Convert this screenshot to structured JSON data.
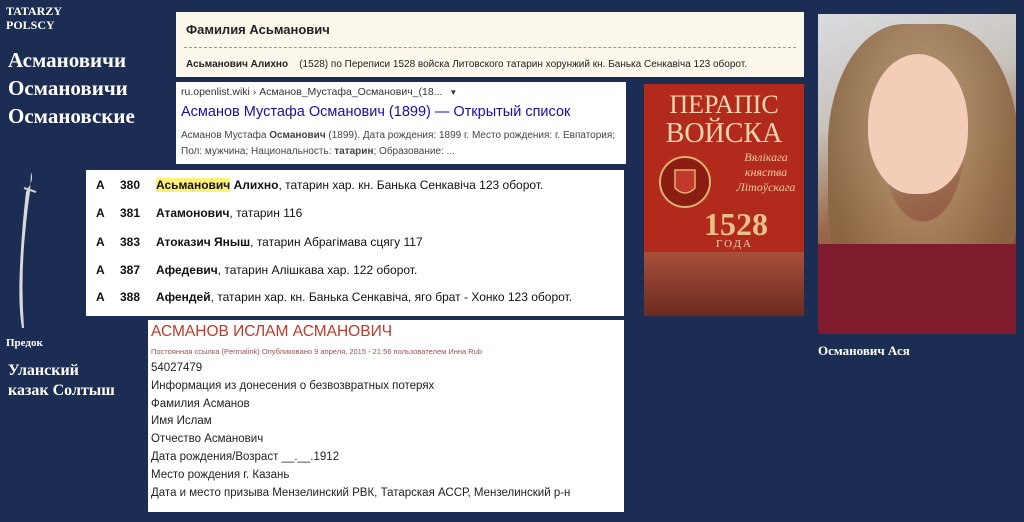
{
  "site_tag": [
    "TATARZY",
    "POLSCY"
  ],
  "surnames": [
    "Асмановичи",
    "Османовичи",
    "Османовские"
  ],
  "ancestor": {
    "label": "Предок",
    "name": [
      "Уланский",
      "казак Солтыш"
    ]
  },
  "panel_dictionary": {
    "title": "Фамилия Асьманович",
    "row_name": "Асьманович Алихно",
    "row_text": "(1528) по Переписи 1528 войска Литовского татарин хорунжий кн. Банька Сенкавіча 123 оборот."
  },
  "panel_search": {
    "url": "ru.openlist.wiki › Асманов_Мустафа_Османович_(18...",
    "url_dropdown": "▼",
    "title": "Асманов Мустафа Османович (1899) — Открытый список",
    "snippet_parts": [
      "Асманов Мустафа ",
      "Османович",
      " (1899). Дата рождения: 1899 г. Место рождения: г. Евпатория; Пол: мужчина; Национальность: ",
      "татарин",
      "; Образование: ..."
    ]
  },
  "panel_list": {
    "rows": [
      {
        "letter": "А",
        "num": "380",
        "name": "Асьманович",
        "name2": " Алихно",
        "rest": ", татарин хар. кн. Банька Сенкавіча 123 оборот.",
        "highlight": true
      },
      {
        "letter": "А",
        "num": "381",
        "name": "Атамонович",
        "name2": "",
        "rest": ", татарин 116",
        "highlight": false
      },
      {
        "letter": "А",
        "num": "383",
        "name": "Атоказич Яныш",
        "name2": "",
        "rest": ", татарин Абрагімава сцягу 117",
        "highlight": false
      },
      {
        "letter": "А",
        "num": "387",
        "name": "Афедевич",
        "name2": "",
        "rest": ", татарин Алішкава хар. 122 оборот.",
        "highlight": false
      },
      {
        "letter": "А",
        "num": "388",
        "name": "Афендей",
        "name2": "",
        "rest": ", татарин хар. кн. Банька Сенкавіча, яго брат - Хонко 123 оборот.",
        "highlight": false
      }
    ]
  },
  "panel_record": {
    "title": "АСМАНОВ ИСЛАМ АСМАНОВИЧ",
    "meta": "Постоянная ссылка (Permalink) Опубликовано 9 апреля, 2015 - 21:56 пользователем Инна Rub",
    "lines": [
      "54027479",
      "Информация из донесения о безвозвратных потерях",
      "Фамилия Асманов",
      "Имя Ислам",
      "Отчество Асманович",
      "Дата рождения/Возраст __.__.1912",
      "Место рождения г. Казань",
      "Дата и место призыва Мензелинский РВК, Татарская АССР, Мензелинский р-н"
    ]
  },
  "book": {
    "title1": "ПЕРАПІС",
    "title2": "ВОЙСКА",
    "subtitle": "Вялікага княства Літоўскага",
    "year": "1528",
    "goda": "ГОДА"
  },
  "photo_caption": "Османович Ася"
}
